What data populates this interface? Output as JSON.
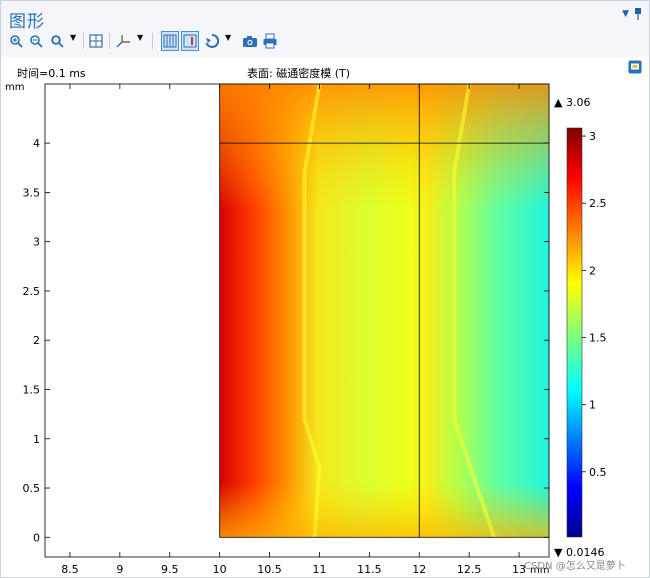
{
  "window": {
    "title": "图形"
  },
  "toolbar": {
    "items": [
      {
        "name": "zoom-in-icon"
      },
      {
        "name": "zoom-out-icon"
      },
      {
        "name": "zoom-box-icon"
      },
      {
        "name": "zoom-extents-icon"
      },
      {
        "name": "axis-orientation-icon"
      },
      {
        "name": "show-grid-icon",
        "active": true
      },
      {
        "name": "show-axis-icon",
        "active": true
      },
      {
        "name": "scene-light-icon"
      },
      {
        "name": "camera-icon"
      },
      {
        "name": "print-icon"
      }
    ]
  },
  "plot": {
    "time_label": "时间=0.1 ms",
    "surface_label": "表面: 磁通密度模 (T)",
    "y_unit": "mm",
    "x_unit": "mm",
    "watermark": "CSDN @怎么又是萝卜"
  },
  "colorbar": {
    "max_label": "▲ 3.06",
    "min_label": "▼ 0.0146",
    "ticks": [
      "0.5",
      "1",
      "1.5",
      "2",
      "2.5",
      "3"
    ]
  },
  "colors": {
    "accent": "#2a6fb8",
    "colormap": [
      "#00008f",
      "#0000ff",
      "#00ffff",
      "#ffff00",
      "#ff0000",
      "#800000"
    ]
  },
  "chart_data": {
    "type": "heatmap",
    "title": "表面: 磁通密度模 (T)",
    "subtitle": "时间=0.1 ms",
    "xlabel": "mm",
    "ylabel": "mm",
    "xlim": [
      8.25,
      13.3
    ],
    "ylim": [
      -0.2,
      4.6
    ],
    "x_ticks": [
      "8.5",
      "9",
      "9.5",
      "10",
      "10.5",
      "11",
      "11.5",
      "12",
      "12.5",
      "13"
    ],
    "y_ticks": [
      "0",
      "0.5",
      "1",
      "1.5",
      "2",
      "2.5",
      "3",
      "3.5",
      "4"
    ],
    "domain": {
      "x": [
        10,
        13.3
      ],
      "y": [
        0,
        4.6
      ]
    },
    "internal_lines": {
      "x": 12,
      "y": 4
    },
    "colorbar_range": [
      0.0146,
      3.06
    ],
    "colorbar_ticks": [
      0.5,
      1,
      1.5,
      2,
      2.5,
      3
    ],
    "samples": [
      {
        "x": 10.05,
        "y": 4.5,
        "value": 3.0
      },
      {
        "x": 10.1,
        "y": 2.0,
        "value": 2.7
      },
      {
        "x": 10.5,
        "y": 2.3,
        "value": 2.35
      },
      {
        "x": 11.0,
        "y": 2.3,
        "value": 1.95
      },
      {
        "x": 11.5,
        "y": 2.3,
        "value": 1.9
      },
      {
        "x": 12.0,
        "y": 2.3,
        "value": 1.95
      },
      {
        "x": 12.0,
        "y": 4.4,
        "value": 2.3
      },
      {
        "x": 12.5,
        "y": 2.3,
        "value": 1.6
      },
      {
        "x": 13.0,
        "y": 2.3,
        "value": 1.25
      },
      {
        "x": 13.2,
        "y": 4.4,
        "value": 1.5
      },
      {
        "x": 11.0,
        "y": 0.1,
        "value": 2.2
      }
    ]
  }
}
